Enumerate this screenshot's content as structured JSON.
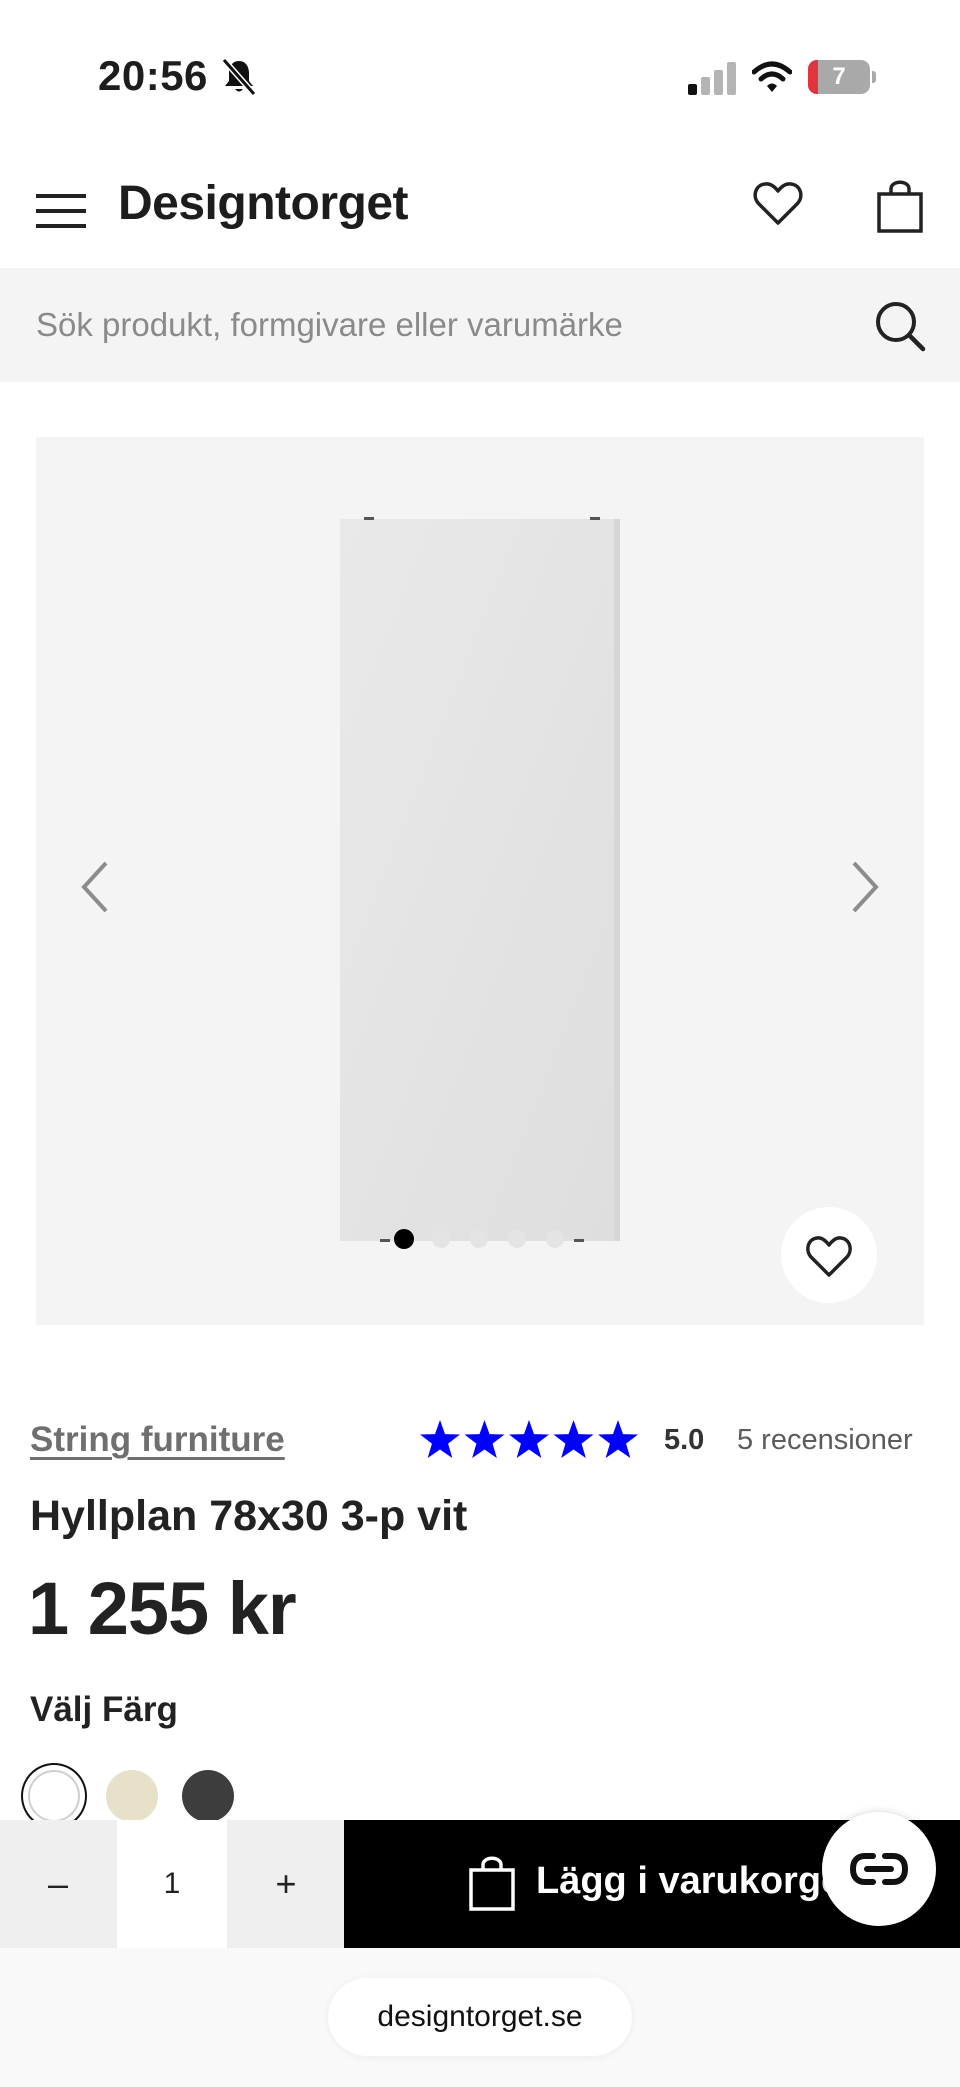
{
  "status_bar": {
    "time": "20:56",
    "battery_level": "7",
    "battery_fraction": 0.07,
    "icons": [
      "bell-muted-icon",
      "signal-icon",
      "wifi-icon",
      "battery-icon"
    ]
  },
  "header": {
    "brand": "Designtorget",
    "icons": [
      "menu-icon",
      "heart-icon",
      "shopping-bag-icon"
    ]
  },
  "search": {
    "placeholder": "Sök produkt, formgivare eller varumärke",
    "value": ""
  },
  "gallery": {
    "image_count": 5,
    "active_index": 0,
    "icons": [
      "chevron-left-icon",
      "chevron-right-icon",
      "heart-icon"
    ]
  },
  "product": {
    "brand": "String furniture",
    "rating": 5.0,
    "rating_text": "5.0",
    "reviews_text": "5 recensioner",
    "title": "Hyllplan 78x30 3-p vit",
    "price": "1 255 kr",
    "color_label": "Välj Färg",
    "colors": [
      {
        "hex": "#ffffff",
        "selected": true
      },
      {
        "hex": "#e6e1c8",
        "selected": false
      },
      {
        "hex": "#3d3d3d",
        "selected": false
      }
    ],
    "star_color": "#0000ff"
  },
  "cart": {
    "minus": "–",
    "quantity": "1",
    "plus": "+",
    "add_label": "Lägg i varukorgen"
  },
  "browser": {
    "url": "designtorget.se"
  }
}
